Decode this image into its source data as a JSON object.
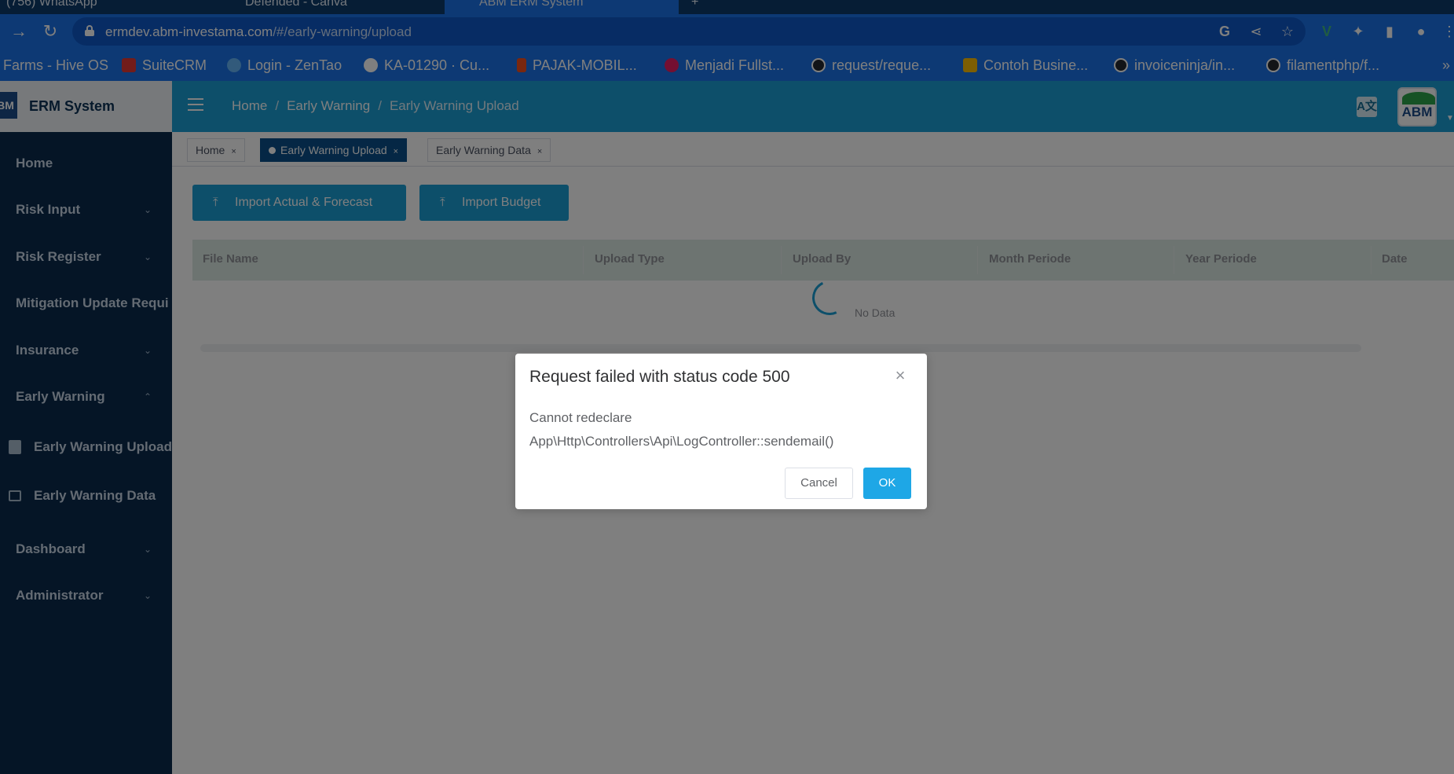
{
  "browser": {
    "tabs": [
      {
        "label": "(756) WhatsApp"
      },
      {
        "label": "Defended - Canva"
      },
      {
        "label": "ABM ERM System",
        "active": true
      }
    ],
    "url_host": "ermdev.abm-investama.com",
    "url_path": "/#/early-warning/upload",
    "bookmarks": [
      {
        "label": "Farms - Hive OS",
        "color": "#1a73e8"
      },
      {
        "label": "SuiteCRM",
        "color": "#e53935"
      },
      {
        "label": "Login - ZenTao",
        "color": "#2196f3"
      },
      {
        "label": "KA-01290 · Cu...",
        "color": "#ffffff"
      },
      {
        "label": "PAJAK-MOBIL...",
        "color": "#f24e1e"
      },
      {
        "label": "Menjadi Fullst...",
        "color": "#e91e63"
      },
      {
        "label": "request/reque...",
        "color": "#24292e"
      },
      {
        "label": "Contoh Busine...",
        "color": "#fbbc05"
      },
      {
        "label": "invoiceninja/in...",
        "color": "#24292e"
      },
      {
        "label": "filamentphp/f...",
        "color": "#24292e"
      }
    ],
    "bookmarks_more": "»"
  },
  "app": {
    "brand_logo": "BM",
    "brand_title": "ERM System",
    "sidebar": {
      "items": [
        {
          "label": "Home",
          "chevron": ""
        },
        {
          "label": "Risk Input",
          "chevron": "⌄"
        },
        {
          "label": "Risk Register",
          "chevron": "⌄"
        },
        {
          "label": "Mitigation Update Requi",
          "chevron": ""
        },
        {
          "label": "Insurance",
          "chevron": "⌄"
        },
        {
          "label": "Early Warning",
          "chevron": "⌃"
        },
        {
          "label": "Dashboard",
          "chevron": "⌄"
        },
        {
          "label": "Administrator",
          "chevron": "⌄"
        }
      ],
      "sub_items": [
        {
          "label": "Early Warning Upload",
          "icon": "clipboard-icon"
        },
        {
          "label": "Early Warning Data",
          "icon": "folder-icon"
        }
      ]
    },
    "breadcrumb": [
      "Home",
      "Early Warning",
      "Early Warning Upload"
    ],
    "breadcrumb_sep": "/",
    "avatar_text": "ABM",
    "translate_icon": "A文",
    "tags": [
      {
        "label": "Home",
        "active": false
      },
      {
        "label": "Early Warning Upload",
        "active": true
      },
      {
        "label": "Early Warning Data",
        "active": false
      }
    ],
    "tag_close": "×",
    "buttons": {
      "import_actual": "Import Actual & Forecast",
      "import_budget": "Import Budget",
      "upload_icon": "⤒"
    },
    "table": {
      "columns": [
        "File Name",
        "Upload Type",
        "Upload By",
        "Month Periode",
        "Year Periode",
        "Date"
      ],
      "empty_text": "No Data"
    }
  },
  "dialog": {
    "title": "Request failed with status code 500",
    "message_line1": "Cannot redeclare",
    "message_line2": "App\\Http\\Controllers\\Api\\LogController::sendemail()",
    "cancel_label": "Cancel",
    "ok_label": "OK",
    "close_glyph": "×"
  },
  "colors": {
    "header_blue": "#1a9ed4",
    "sidebar_bg": "#0a2a4d",
    "browser_blue": "#1a73e8",
    "active_tag": "#0a4f8a",
    "ok_button": "#1ea7e6"
  }
}
